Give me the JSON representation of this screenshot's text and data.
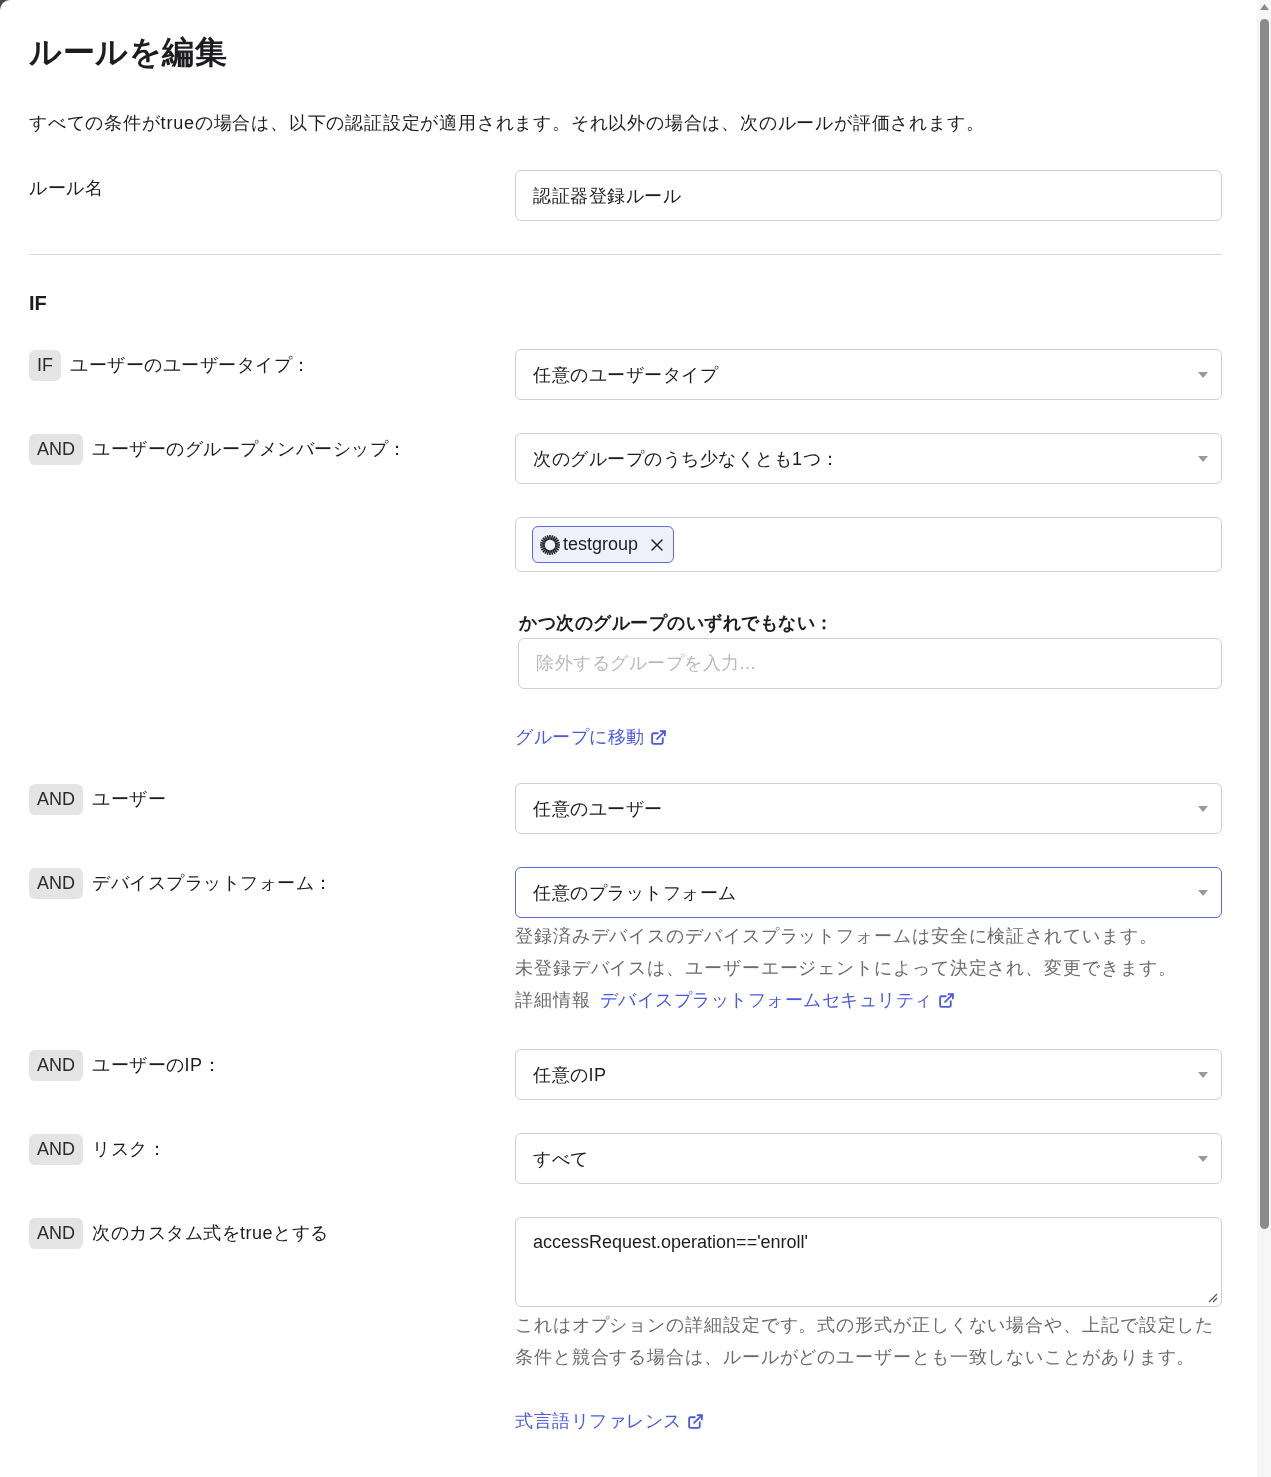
{
  "title": "ルールを編集",
  "description": "すべての条件がtrueの場合は、以下の認証設定が適用されます。それ以外の場合は、次のルールが評価されます。",
  "rule_name": {
    "label": "ルール名",
    "value": "認証器登録ルール"
  },
  "section_title": "IF",
  "conditions": [
    {
      "operator": "IF",
      "label": "ユーザーのユーザータイプ：",
      "controls": [
        {
          "kind": "select",
          "value": "任意のユーザータイプ",
          "focused": false
        }
      ]
    },
    {
      "operator": "AND",
      "label": "ユーザーのグループメンバーシップ：",
      "controls": [
        {
          "kind": "select",
          "value": "次のグループのうち少なくとも1つ：",
          "focused": false
        },
        {
          "kind": "tags",
          "tags": [
            {
              "label": "testgroup"
            }
          ]
        },
        {
          "kind": "field",
          "label": "かつ次のグループのいずれでもない：",
          "placeholder": "除外するグループを入力..."
        },
        {
          "kind": "link",
          "label": "グループに移動"
        }
      ]
    },
    {
      "operator": "AND",
      "label": "ユーザー",
      "controls": [
        {
          "kind": "select",
          "value": "任意のユーザー",
          "focused": false
        }
      ]
    },
    {
      "operator": "AND",
      "label": "デバイスプラットフォーム：",
      "controls": [
        {
          "kind": "select",
          "value": "任意のプラットフォーム",
          "focused": true
        },
        {
          "kind": "help",
          "lines": [
            "登録済みデバイスのデバイスプラットフォームは安全に検証されています。",
            "未登録デバイスは、ユーザーエージェントによって決定され、変更できます。"
          ],
          "details": {
            "label": "詳細情報",
            "link": "デバイスプラットフォームセキュリティ"
          }
        }
      ]
    },
    {
      "operator": "AND",
      "label": "ユーザーのIP：",
      "controls": [
        {
          "kind": "select",
          "value": "任意のIP",
          "focused": false
        }
      ]
    },
    {
      "operator": "AND",
      "label": "リスク：",
      "controls": [
        {
          "kind": "select",
          "value": "すべて",
          "focused": false
        }
      ]
    },
    {
      "operator": "AND",
      "label": "次のカスタム式をtrueとする",
      "controls": [
        {
          "kind": "textarea",
          "value": "accessRequest.operation=='enroll'"
        },
        {
          "kind": "help",
          "lines": [
            "これはオプションの詳細設定です。式の形式が正しくない場合や、上記で設定した条件と競合する場合は、ルールがどのユーザーとも一致しないことがあります。"
          ]
        },
        {
          "kind": "link",
          "label": "式言語リファレンス"
        }
      ]
    }
  ]
}
